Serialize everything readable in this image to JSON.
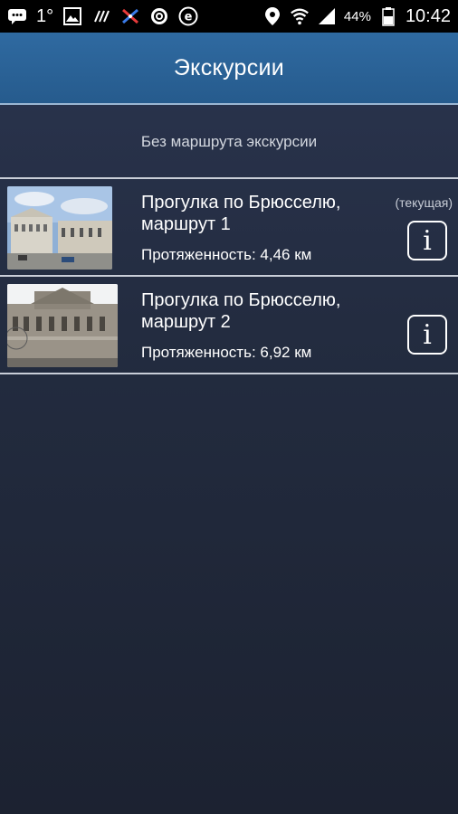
{
  "status_bar": {
    "temperature": "1°",
    "battery_percent": "44%",
    "time": "10:42",
    "icons_left": [
      "chat-icon",
      "gallery-icon",
      "network-activity-icon",
      "sports-app-icon",
      "sync-icon",
      "e-app-icon"
    ],
    "icons_right": [
      "location-icon",
      "wifi-icon",
      "cellular-signal-icon",
      "battery-icon"
    ]
  },
  "app_bar": {
    "title": "Экскурсии"
  },
  "no_route": {
    "label": "Без маршрута экскурсии"
  },
  "routes": [
    {
      "title_line1": "Прогулка по Брюсселю,",
      "title_line2": "маршрут 1",
      "length": "Протяженность: 4,46 км",
      "current_label": "(текущая)",
      "info_glyph": "i"
    },
    {
      "title_line1": "Прогулка по Брюсселю,",
      "title_line2": "маршрут 2",
      "length": "Протяженность: 6,92 км",
      "info_glyph": "i"
    }
  ],
  "colors": {
    "app_bar": "#2a6096",
    "background": "#232c40",
    "divider": "#c9ced8"
  }
}
